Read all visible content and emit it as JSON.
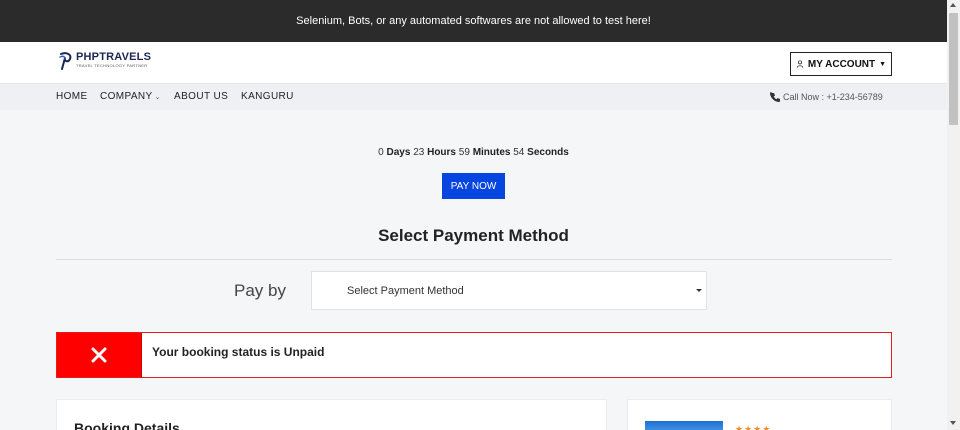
{
  "notice": "Selenium, Bots, or any automated softwares are not allowed to test here!",
  "logo": {
    "title": "PHPTRAVELS",
    "subtitle": "TRAVEL TECHNOLOGY PARTNER",
    "icon": "phptravels-logo-icon"
  },
  "account": {
    "label": "MY ACCOUNT",
    "icon": "user-icon"
  },
  "nav": {
    "items": [
      {
        "label": "HOME"
      },
      {
        "label": "COMPANY"
      },
      {
        "label": "ABOUT US"
      },
      {
        "label": "KANGURU"
      }
    ],
    "call": "Call Now : +1-234-56789",
    "call_icon": "phone-icon"
  },
  "countdown": {
    "days": "0",
    "days_label": "Days",
    "hours": "23",
    "hours_label": "Hours",
    "minutes": "59",
    "minutes_label": "Minutes",
    "seconds": "54",
    "seconds_label": "Seconds"
  },
  "pay_now": "PAY NOW",
  "payment": {
    "title": "Select Payment Method",
    "pay_by": "Pay by",
    "select_value": "Select Payment Method"
  },
  "alert": {
    "text": "Your booking status is Unpaid",
    "color": "#ff0000",
    "icon": "close-x-icon"
  },
  "booking": {
    "title": "Booking Details"
  },
  "hotel": {
    "stars": "★★★★"
  },
  "colors": {
    "primary": "#0645e0",
    "topbar": "#2b2b2b",
    "alert": "#ff0000"
  }
}
